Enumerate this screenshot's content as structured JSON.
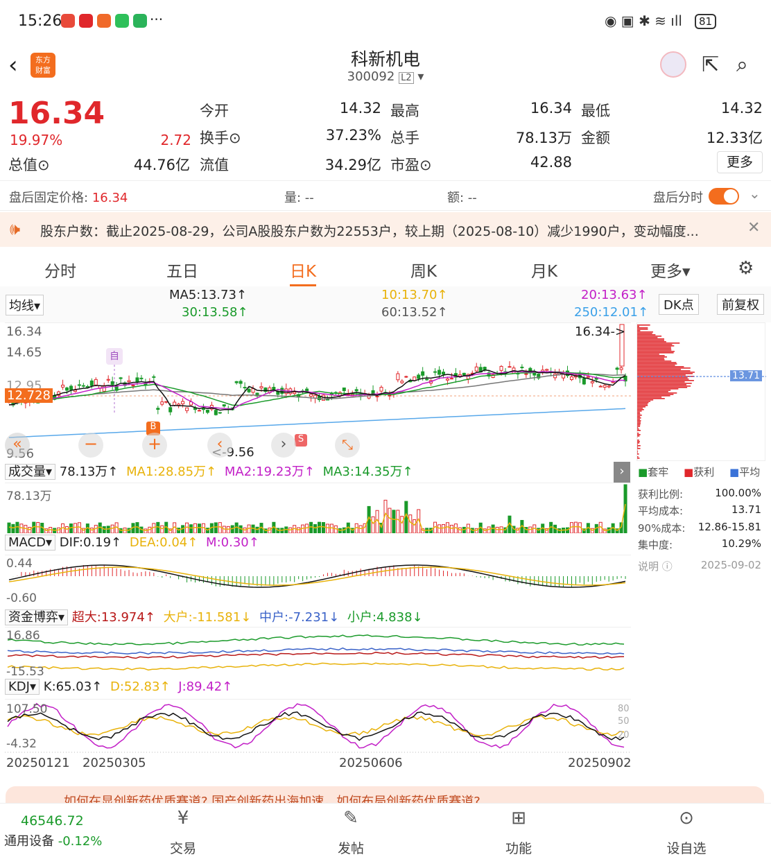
{
  "status": {
    "time": "15:26",
    "battery": "81"
  },
  "header": {
    "title": "科新机电",
    "code": "300092",
    "level": "L2",
    "logo_line1": "东方",
    "logo_line2": "财富"
  },
  "quote": {
    "price": "16.34",
    "pct": "19.97%",
    "chg": "2.72",
    "open_label": "今开",
    "open": "14.32",
    "high_label": "最高",
    "high": "16.34",
    "low_label": "最低",
    "low": "14.32",
    "turnover_label": "换手",
    "turnover": "37.23%",
    "vol_label": "总手",
    "vol": "78.13万",
    "amt_label": "金额",
    "amt": "12.33亿",
    "mcap_label": "总值",
    "mcap": "44.76亿",
    "float_label": "流值",
    "float": "34.29亿",
    "pe_label": "市盈",
    "pe": "42.88",
    "more": "更多"
  },
  "after": {
    "label": "盘后固定价格:",
    "price": "16.34",
    "vol": "量: --",
    "amt": "额: --",
    "toggle_label": "盘后分时"
  },
  "notice": {
    "text": "股东户数：截止2025-08-29，公司A股股东户数为22553户，较上期（2025-08-10）减少1990户，变动幅度..."
  },
  "tabs": [
    "分时",
    "五日",
    "日K",
    "周K",
    "月K",
    "更多▾"
  ],
  "ma": {
    "selector": "均线",
    "ma5": "MA5:13.73↑",
    "ma10": "10:13.70↑",
    "ma20": "20:13.63↑",
    "ma30": "30:13.58↑",
    "ma60": "60:13.52↑",
    "ma250": "250:12.01↑",
    "dk": "DK点",
    "fq": "前复权"
  },
  "kchart": {
    "ymax": "16.34",
    "y2": "14.65",
    "y3": "12.95",
    "cur": "12.728",
    "ymin": "9.56",
    "high_mark": "16.34->",
    "low_mark": "<-9.56",
    "self": "自",
    "b": "B",
    "s": "S",
    "cost_tag": "13.71"
  },
  "vol": {
    "selector": "成交量",
    "v": "78.13万↑",
    "ma1": "MA1:28.85万↑",
    "ma2": "MA2:19.23万↑",
    "ma3": "MA3:14.35万↑",
    "ymax": "78.13万"
  },
  "macd": {
    "selector": "MACD",
    "dif": "DIF:0.19↑",
    "dea": "DEA:0.04↑",
    "m": "M:0.30↑",
    "ymax": "0.44",
    "ymin": "-0.60"
  },
  "fund": {
    "selector": "资金博弈",
    "super": "超大:13.974↑",
    "big": "大户:-11.581↓",
    "mid": "中户:-7.231↓",
    "small": "小户:4.838↓",
    "ymax": "16.86",
    "ymin": "-15.53"
  },
  "kdj": {
    "selector": "KDJ",
    "k": "K:65.03↑",
    "d": "D:52.83↑",
    "j": "J:89.42↑",
    "ymax": "107.50",
    "ymin": "-4.32",
    "r80": "80",
    "r50": "50",
    "r20": "20"
  },
  "dates": [
    "20250121",
    "20250305",
    "20250606",
    "20250902"
  ],
  "chips": {
    "l1": "套牢",
    "l2": "获利",
    "l3": "平均",
    "ratio_label": "获利比例:",
    "ratio": "100.00%",
    "avg_label": "平均成本:",
    "avg": "13.71",
    "c90_label": "90%成本:",
    "c90": "12.86-15.81",
    "conc_label": "集中度:",
    "conc": "10.29%",
    "note": "说明",
    "date": "2025-09-02"
  },
  "ad": {
    "text": "如何在显创新药优质赛道?    国产创新药出海加速，如何布局创新药优质赛道?"
  },
  "nav": {
    "index": "46546.72",
    "index_name": "通用设备",
    "index_pct": "-0.12%",
    "trade": "交易",
    "post": "发帖",
    "func": "功能",
    "watch": "设自选"
  }
}
